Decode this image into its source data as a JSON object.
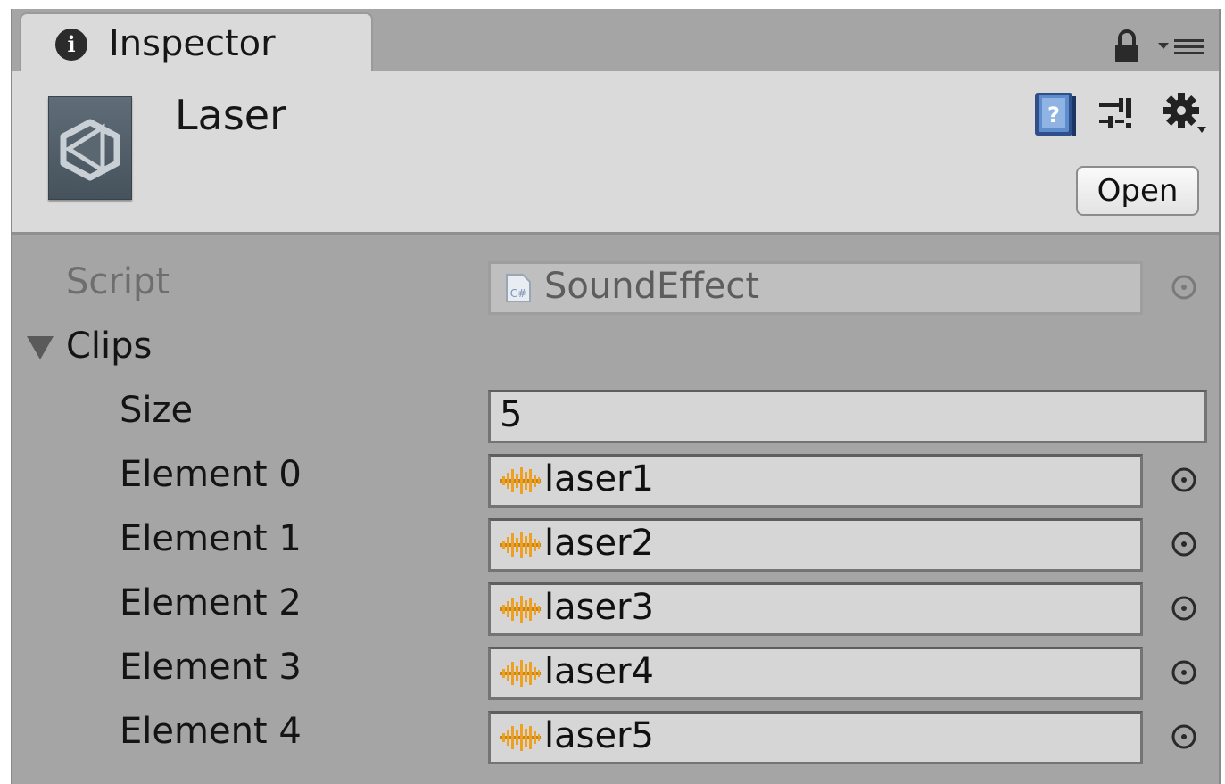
{
  "window": {
    "tab_title": "Inspector",
    "tab_icon": "info-icon",
    "tab_icon_glyph": "i"
  },
  "header": {
    "asset_name": "Laser",
    "asset_icon": "unity-script-asset-icon",
    "help_icon": "help-book-icon",
    "preset_icon": "preset-sliders-icon",
    "gear_icon": "gear-icon",
    "open_label": "Open"
  },
  "properties": {
    "script": {
      "label": "Script",
      "value": "SoundEffect",
      "type_badge": "C#",
      "icon": "csharp-script-icon"
    },
    "clips": {
      "label": "Clips",
      "expanded": true,
      "size_label": "Size",
      "size_value": "5",
      "elements": [
        {
          "label": "Element 0",
          "value": "laser1",
          "icon": "audio-clip-icon"
        },
        {
          "label": "Element 1",
          "value": "laser2",
          "icon": "audio-clip-icon"
        },
        {
          "label": "Element 2",
          "value": "laser3",
          "icon": "audio-clip-icon"
        },
        {
          "label": "Element 3",
          "value": "laser4",
          "icon": "audio-clip-icon"
        },
        {
          "label": "Element 4",
          "value": "laser5",
          "icon": "audio-clip-icon"
        }
      ]
    }
  },
  "colors": {
    "panel_bg": "#a5a5a5",
    "header_bg": "#dadada",
    "field_bg": "#d6d6d6",
    "audio_icon": "#f0a020"
  }
}
